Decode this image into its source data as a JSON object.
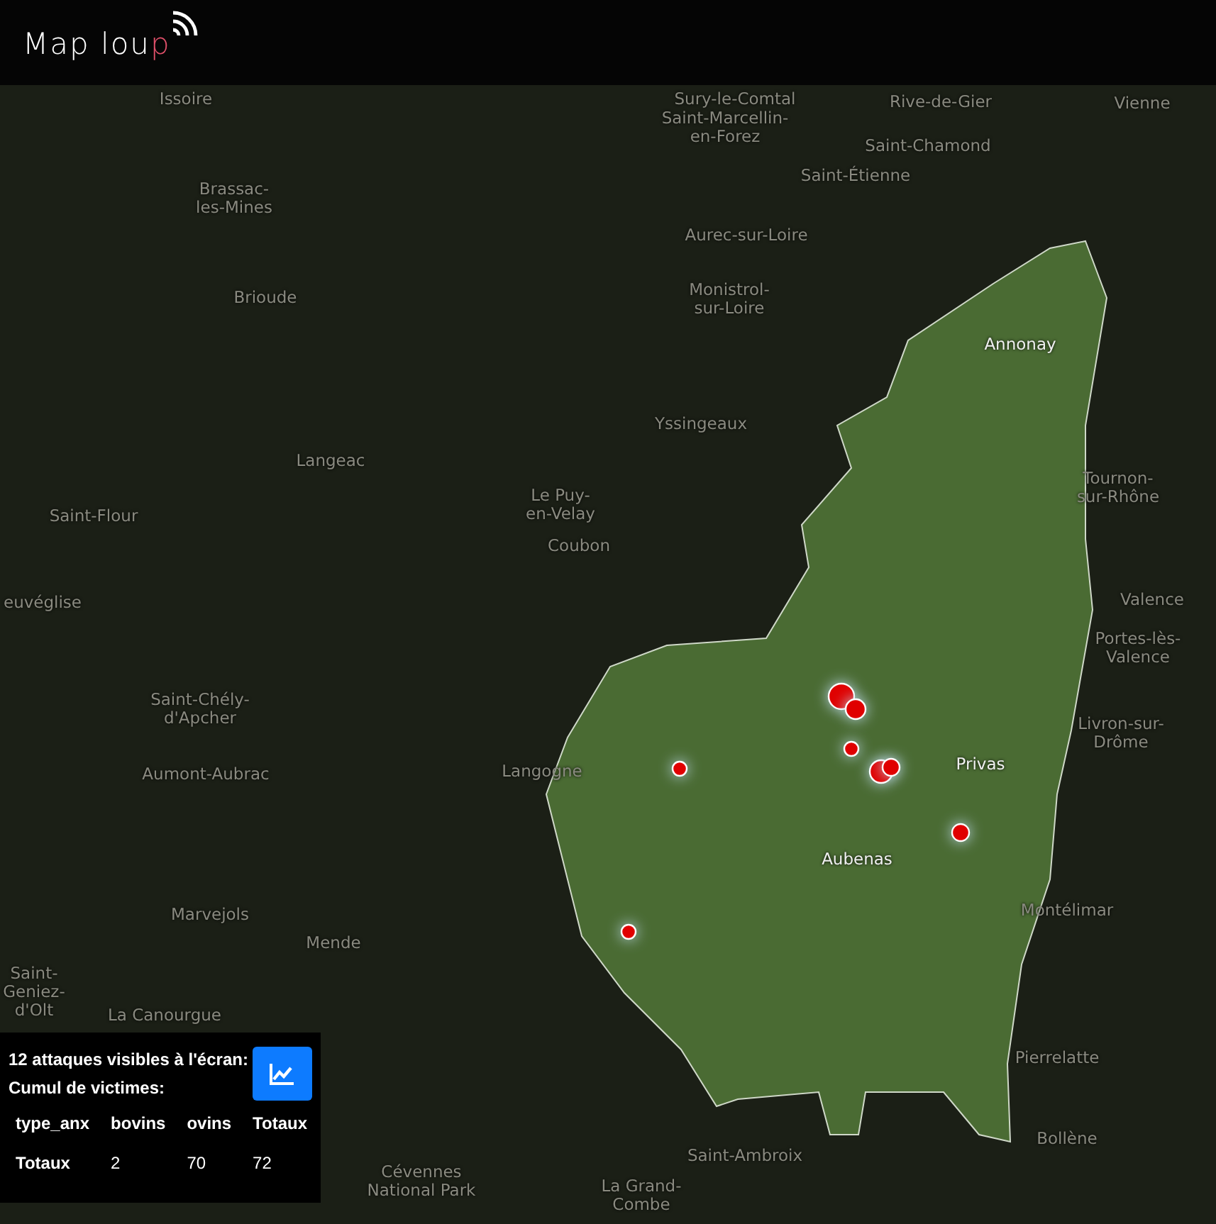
{
  "header": {
    "logo": {
      "text": "Map lou",
      "accent": "p"
    }
  },
  "map": {
    "place_labels": [
      {
        "text": "Issoire",
        "highlight": false
      },
      {
        "text": "Sury-le-Comtal",
        "highlight": false
      },
      {
        "text": "Saint-Marcellin-\nen-Forez",
        "highlight": false
      },
      {
        "text": "Rive-de-Gier",
        "highlight": false
      },
      {
        "text": "Vienne",
        "highlight": false
      },
      {
        "text": "Saint-Chamond",
        "highlight": false
      },
      {
        "text": "Saint-Étienne",
        "highlight": false
      },
      {
        "text": "Aurec-sur-Loire",
        "highlight": false
      },
      {
        "text": "Monistrol-\nsur-Loire",
        "highlight": false
      },
      {
        "text": "Yssingeaux",
        "highlight": false
      },
      {
        "text": "Brassac-\nles-Mines",
        "highlight": false
      },
      {
        "text": "Brioude",
        "highlight": false
      },
      {
        "text": "Langeac",
        "highlight": false
      },
      {
        "text": "Le Puy-\nen-Velay",
        "highlight": false
      },
      {
        "text": "Coubon",
        "highlight": false
      },
      {
        "text": "Saint-Flour",
        "highlight": false
      },
      {
        "text": "euvéglise",
        "highlight": false
      },
      {
        "text": "Annonay",
        "highlight": true
      },
      {
        "text": "Tournon-\nsur-Rhône",
        "highlight": false
      },
      {
        "text": "Valence",
        "highlight": false
      },
      {
        "text": "Portes-lès-\nValence",
        "highlight": false
      },
      {
        "text": "Livron-sur-\nDrôme",
        "highlight": false
      },
      {
        "text": "Privas",
        "highlight": true
      },
      {
        "text": "Aubenas",
        "highlight": true
      },
      {
        "text": "Montélimar",
        "highlight": false
      },
      {
        "text": "Pierrelatte",
        "highlight": false
      },
      {
        "text": "Bollène",
        "highlight": false
      },
      {
        "text": "Saint-Ambroix",
        "highlight": false
      },
      {
        "text": "La Grand-\nCombe",
        "highlight": false
      },
      {
        "text": "Langogne",
        "highlight": false
      },
      {
        "text": "Saint-Chély-\nd'Apcher",
        "highlight": false
      },
      {
        "text": "Aumont-Aubrac",
        "highlight": false
      },
      {
        "text": "Marvejols",
        "highlight": false
      },
      {
        "text": "Mende",
        "highlight": false
      },
      {
        "text": "Saint-\nGeniez-\nd'Olt",
        "highlight": false
      },
      {
        "text": "La Canourgue",
        "highlight": false
      },
      {
        "text": "Cévennes\nNational Park",
        "highlight": false
      }
    ]
  },
  "summary": {
    "title": "12 attaques visibles à l'écran:",
    "subtitle": "Cumul de victimes:",
    "table": {
      "columns": [
        "type_anx",
        "bovins",
        "ovins",
        "Totaux"
      ],
      "rows": [
        [
          "Totaux",
          "2",
          "70",
          "72"
        ]
      ]
    }
  }
}
